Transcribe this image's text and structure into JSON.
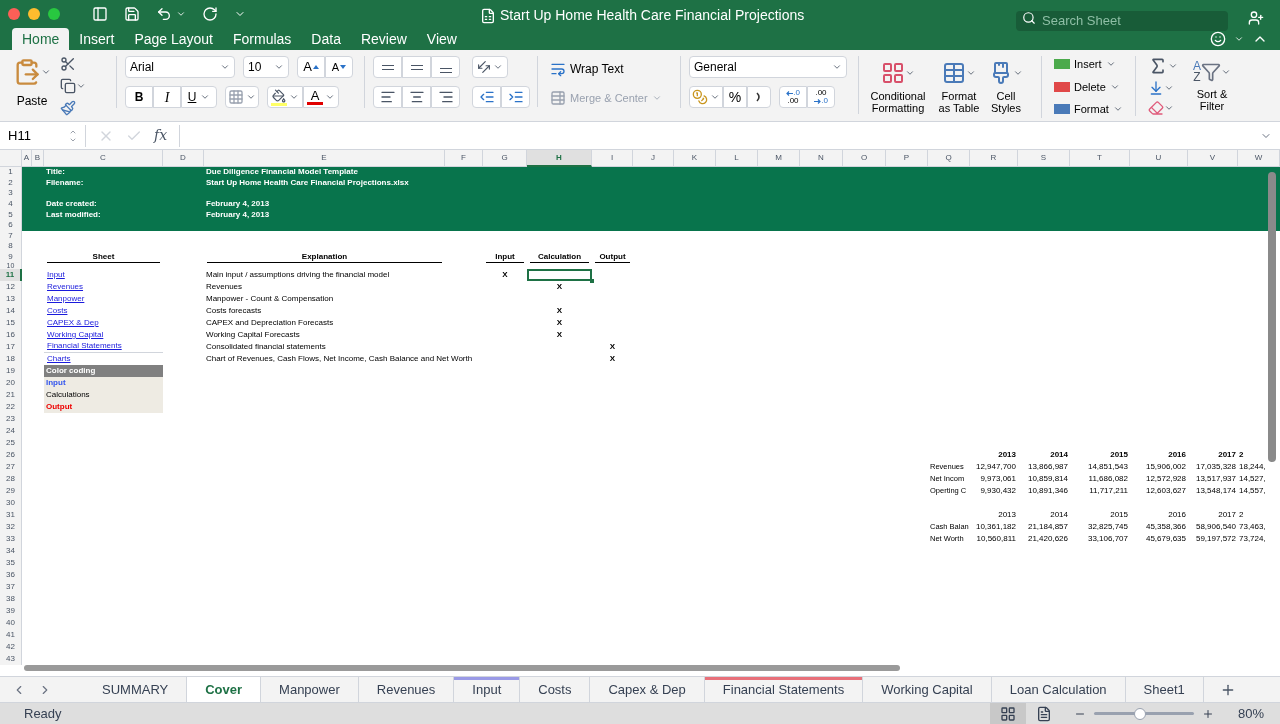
{
  "window": {
    "title": "Start Up Home Health Care Financial Projections"
  },
  "search": {
    "placeholder": "Search Sheet"
  },
  "ribbon_tabs": [
    {
      "label": "Home",
      "selected": true
    },
    {
      "label": "Insert",
      "selected": false
    },
    {
      "label": "Page Layout",
      "selected": false
    },
    {
      "label": "Formulas",
      "selected": false
    },
    {
      "label": "Data",
      "selected": false
    },
    {
      "label": "Review",
      "selected": false
    },
    {
      "label": "View",
      "selected": false
    }
  ],
  "ribbon": {
    "paste": "Paste",
    "font": "Arial",
    "font_size": "10",
    "grow_font": "A",
    "shrink_font": "A",
    "bold": "B",
    "italic": "I",
    "underline": "U",
    "font_color": "A",
    "wrap_text": "Wrap Text",
    "merge": "Merge & Center",
    "merge_disabled": true,
    "number_format": "General",
    "percent": "%",
    "increase_decimal": [
      ".0",
      ".00"
    ],
    "decrease_decimal": [
      ".00",
      ".0"
    ],
    "styles": [
      "Conditional Formatting",
      "Format as Table",
      "Cell Styles"
    ],
    "cells": [
      "Insert",
      "Delete",
      "Format"
    ],
    "sort_letters": [
      "A",
      "Z"
    ],
    "sort_filter": "Sort & Filter"
  },
  "formula_bar": {
    "name_box": "H11",
    "fx": "fx"
  },
  "columns": [
    {
      "label": "A",
      "selected": false
    },
    {
      "label": "B",
      "selected": false
    },
    {
      "label": "C",
      "selected": false
    },
    {
      "label": "D",
      "selected": false
    },
    {
      "label": "E",
      "selected": false
    },
    {
      "label": "F",
      "selected": false
    },
    {
      "label": "G",
      "selected": false
    },
    {
      "label": "H",
      "selected": true
    },
    {
      "label": "I",
      "selected": false
    },
    {
      "label": "J",
      "selected": false
    },
    {
      "label": "K",
      "selected": false
    },
    {
      "label": "L",
      "selected": false
    },
    {
      "label": "M",
      "selected": false
    },
    {
      "label": "N",
      "selected": false
    },
    {
      "label": "O",
      "selected": false
    },
    {
      "label": "P",
      "selected": false
    },
    {
      "label": "Q",
      "selected": false
    },
    {
      "label": "R",
      "selected": false
    },
    {
      "label": "S",
      "selected": false
    },
    {
      "label": "T",
      "selected": false
    },
    {
      "label": "U",
      "selected": false
    },
    {
      "label": "V",
      "selected": false
    },
    {
      "label": "W",
      "selected": false
    }
  ],
  "rows": [
    {
      "label": "1",
      "selected": false
    },
    {
      "label": "2",
      "selected": false
    },
    {
      "label": "3",
      "selected": false
    },
    {
      "label": "4",
      "selected": false
    },
    {
      "label": "5",
      "selected": false
    },
    {
      "label": "6",
      "selected": false
    },
    {
      "label": "7",
      "selected": false
    },
    {
      "label": "8",
      "selected": false
    },
    {
      "label": "9",
      "selected": false
    },
    {
      "label": "10",
      "selected": false
    },
    {
      "label": "11",
      "selected": true
    },
    {
      "label": "12",
      "selected": false
    },
    {
      "label": "13",
      "selected": false
    },
    {
      "label": "14",
      "selected": false
    },
    {
      "label": "15",
      "selected": false
    },
    {
      "label": "16",
      "selected": false
    },
    {
      "label": "17",
      "selected": false
    },
    {
      "label": "18",
      "selected": false
    },
    {
      "label": "19",
      "selected": false
    },
    {
      "label": "20",
      "selected": false
    },
    {
      "label": "21",
      "selected": false
    },
    {
      "label": "22",
      "selected": false
    },
    {
      "label": "23",
      "selected": false
    },
    {
      "label": "24",
      "selected": false
    },
    {
      "label": "25",
      "selected": false
    },
    {
      "label": "26",
      "selected": false
    },
    {
      "label": "27",
      "selected": false
    },
    {
      "label": "28",
      "selected": false
    },
    {
      "label": "29",
      "selected": false
    },
    {
      "label": "30",
      "selected": false
    },
    {
      "label": "31",
      "selected": false
    },
    {
      "label": "32",
      "selected": false
    },
    {
      "label": "33",
      "selected": false
    },
    {
      "label": "34",
      "selected": false
    },
    {
      "label": "35",
      "selected": false
    },
    {
      "label": "36",
      "selected": false
    },
    {
      "label": "37",
      "selected": false
    },
    {
      "label": "38",
      "selected": false
    },
    {
      "label": "39",
      "selected": false
    },
    {
      "label": "40",
      "selected": false
    },
    {
      "label": "41",
      "selected": false
    },
    {
      "label": "42",
      "selected": false
    },
    {
      "label": "43",
      "selected": false
    }
  ],
  "banner": [
    {
      "label": "Title:",
      "value": "Due Diligence Financial Model Template"
    },
    {
      "label": "Filename:",
      "value": "Start Up Home Health Care Financial Projections.xlsx"
    },
    {
      "label": "Date created:",
      "value": "February 4, 2013"
    },
    {
      "label": "Last modified:",
      "value": "February 4, 2013"
    }
  ],
  "sheet_table": {
    "headers": [
      "Sheet",
      "Explanation",
      "Input",
      "Calculation",
      "Output"
    ],
    "rows": [
      {
        "sheet": "Input",
        "explanation": "Main input / assumptions driving the financial model",
        "input": "X",
        "active": true
      },
      {
        "sheet": "Revenues",
        "explanation": "Revenues",
        "calculation": "X",
        "active": false
      },
      {
        "sheet": "Manpower",
        "explanation": "Manpower - Count & Compensation",
        "active": false
      },
      {
        "sheet": "Costs",
        "explanation": "Costs forecasts",
        "calculation": "X",
        "active": false
      },
      {
        "sheet": "CAPEX & Dep",
        "explanation": "CAPEX and Depreciation Forecasts",
        "calculation": "X",
        "active": false
      },
      {
        "sheet": "Working Capital",
        "explanation": "Working Capital Forecasts",
        "calculation": "X",
        "active": false
      },
      {
        "sheet": "Financial Statements",
        "explanation": "Consolidated financial statements",
        "output": "X",
        "active": false
      },
      {
        "sheet": "Charts",
        "explanation": "Chart of Revenues, Cash Flows, Net Income, Cash Balance and Net Worth",
        "output": "X",
        "active": false
      }
    ]
  },
  "color_coding": {
    "title": "Color coding",
    "items": [
      {
        "label": "Input",
        "kind": "input"
      },
      {
        "label": "Calculations",
        "kind": "calculation"
      },
      {
        "label": "Output",
        "kind": "output"
      }
    ]
  },
  "summary_tables": [
    {
      "bold_years": true,
      "years": [
        "2013",
        "2014",
        "2015",
        "2016",
        "2017",
        "2"
      ],
      "rows": [
        {
          "label": "Revenues",
          "values": [
            "12,947,700",
            "13,866,987",
            "14,851,543",
            "15,906,002",
            "17,035,328",
            "18,244,"
          ]
        },
        {
          "label": "Net Incom",
          "values": [
            "9,973,061",
            "10,859,814",
            "11,686,082",
            "12,572,928",
            "13,517,937",
            "14,527,"
          ]
        },
        {
          "label": "Operting C",
          "values": [
            "9,930,432",
            "10,891,346",
            "11,717,211",
            "12,603,627",
            "13,548,174",
            "14,557,"
          ]
        }
      ]
    },
    {
      "bold_years": false,
      "years": [
        "2013",
        "2014",
        "2015",
        "2016",
        "2017",
        "2"
      ],
      "rows": [
        {
          "label": "Cash Balan",
          "values": [
            "10,361,182",
            "21,184,857",
            "32,825,745",
            "45,358,366",
            "58,906,540",
            "73,463,"
          ]
        },
        {
          "label": "Net Worth",
          "values": [
            "10,560,811",
            "21,420,626",
            "33,106,707",
            "45,679,635",
            "59,197,572",
            "73,724,"
          ]
        }
      ]
    }
  ],
  "sheet_tabs": [
    {
      "label": "SUMMARY",
      "selected": false
    },
    {
      "label": "Cover",
      "selected": true
    },
    {
      "label": "Manpower",
      "selected": false
    },
    {
      "label": "Revenues",
      "selected": false
    },
    {
      "label": "Input",
      "selected": false,
      "color": "#9a9ae6"
    },
    {
      "label": "Costs",
      "selected": false
    },
    {
      "label": "Capex & Dep",
      "selected": false
    },
    {
      "label": "Financial Statements",
      "selected": false,
      "color": "#e8707a"
    },
    {
      "label": "Working Capital",
      "selected": false
    },
    {
      "label": "Loan Calculation",
      "selected": false
    },
    {
      "label": "Sheet1",
      "selected": false
    }
  ],
  "status_bar": {
    "status": "Ready",
    "zoom": "80%",
    "level": 0.45
  }
}
